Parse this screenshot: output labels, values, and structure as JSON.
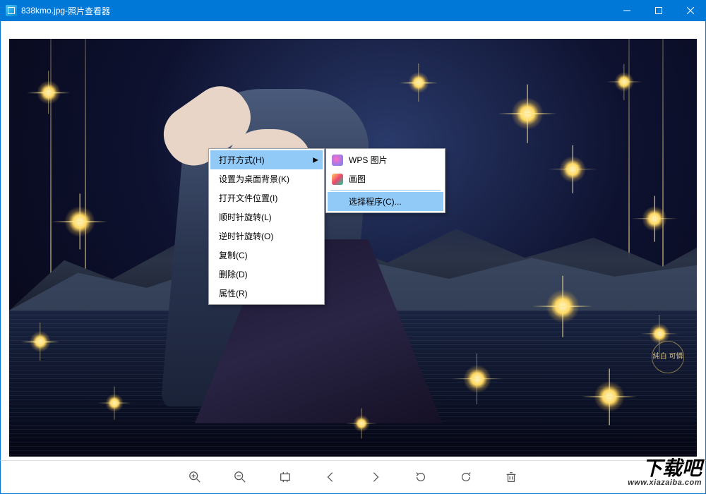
{
  "titlebar": {
    "filename": "838kmo.jpg",
    "separator": " - ",
    "app_name": "照片查看器"
  },
  "context_menu": {
    "items": [
      {
        "label": "打开方式(H)",
        "has_submenu": true,
        "highlighted": true
      },
      {
        "label": "设置为桌面背景(K)"
      },
      {
        "label": "打开文件位置(I)"
      },
      {
        "label": "顺时针旋转(L)"
      },
      {
        "label": "逆时针旋转(O)"
      },
      {
        "label": "复制(C)"
      },
      {
        "label": "删除(D)"
      },
      {
        "label": "属性(R)"
      }
    ]
  },
  "submenu": {
    "items": [
      {
        "label": "WPS 图片",
        "icon": "wps"
      },
      {
        "label": "画图",
        "icon": "paint"
      }
    ],
    "choose_program": "选择程序(C)..."
  },
  "toolbar": {
    "zoom_in": "zoom-in",
    "zoom_out": "zoom-out",
    "fit": "fit-screen",
    "prev": "previous",
    "next": "next",
    "rotate_ccw": "rotate-ccw",
    "rotate_cw": "rotate-cw",
    "delete": "delete"
  },
  "image_watermark": "純白\n可憐",
  "footer_watermark": {
    "text": "下载吧",
    "url": "www.xiazaiba.com"
  }
}
